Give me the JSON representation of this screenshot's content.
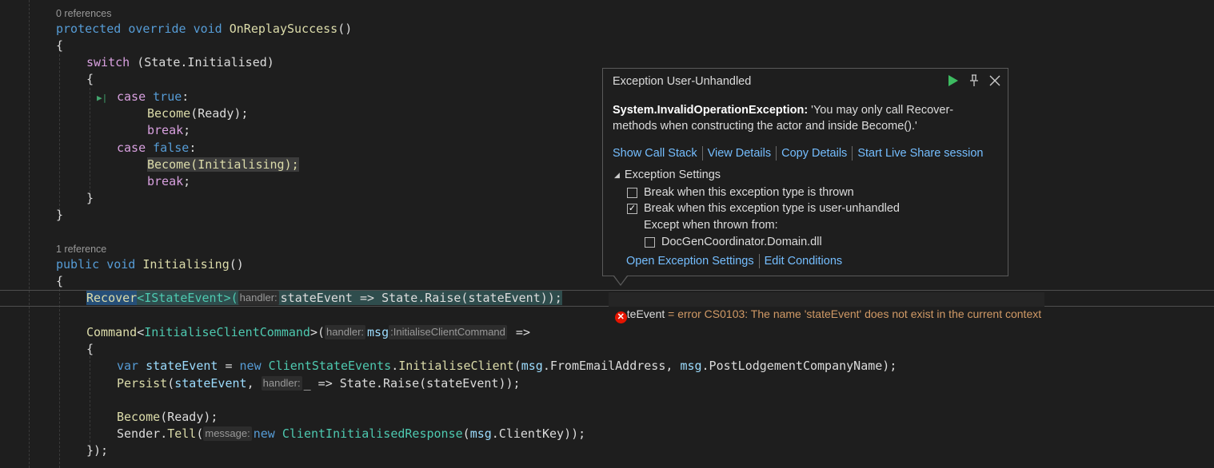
{
  "codelens": {
    "ref1": "0 references",
    "ref2": "1 reference"
  },
  "code": {
    "l1": {
      "protected": "protected",
      "override": "override",
      "void": "void",
      "name": "OnReplaySuccess",
      "rest": "()"
    },
    "l2": "{",
    "l3": {
      "switch": "switch",
      "rest": " (State.Initialised)"
    },
    "l4": "{",
    "l5": {
      "case": "case",
      "val": "true",
      "colon": ":"
    },
    "l6": {
      "fn": "Become",
      "rest": "(Ready);"
    },
    "l7": {
      "kw": "break",
      "semi": ";"
    },
    "l8": {
      "case": "case",
      "val": "false",
      "colon": ":"
    },
    "l9": {
      "text": "Become(Initialising);"
    },
    "l10": {
      "kw": "break",
      "semi": ";"
    },
    "l11": "}",
    "l12": "}",
    "l13": {
      "public": "public",
      "void": "void",
      "name": "Initialising",
      "rest": "()"
    },
    "l14": "{",
    "l15": {
      "recover": "Recover",
      "gen": "<IStateEvent>(",
      "hint": "handler:",
      "rest": "stateEvent => State.Raise(stateEvent));"
    },
    "l16": {
      "cmd": "Command",
      "lt": "<",
      "type": "InitialiseClientCommand",
      "gt": ">(",
      "hint1": "handler:",
      "msg": "msg",
      "hint2": ":InitialiseClientCommand",
      "arrow": " =>"
    },
    "l17": "{",
    "l18": {
      "var": "var",
      "name": "stateEvent",
      "eq": " = ",
      "new": "new",
      "type": "ClientStateEvents",
      "dot": ".",
      "fn": "InitialiseClient",
      "p1": "(",
      "msg1": "msg",
      "d1": ".FromEmailAddress, ",
      "msg2": "msg",
      "d2": ".PostLodgementCompanyName);"
    },
    "l19": {
      "fn": "Persist",
      "a": "(",
      "arg": "stateEvent",
      "comma": ", ",
      "hint": "handler:",
      "rest": "_ => State.Raise(stateEvent));"
    },
    "l20": {
      "fn": "Become",
      "rest": "(Ready);"
    },
    "l21": {
      "sender": "Sender",
      "dot": ".",
      "fn": "Tell",
      "p": "(",
      "hint": "message:",
      "new": "new",
      "type": "ClientInitialisedResponse",
      "rest1": "(",
      "msg": "msg",
      "rest2": ".ClientKey));"
    },
    "l22": "});"
  },
  "error_adornment": {
    "name": "teEvent",
    "eq": " = ",
    "message": "error CS0103: The name 'stateEvent' does not exist in the current context"
  },
  "popup": {
    "title": "Exception User-Unhandled",
    "exception_type": "System.InvalidOperationException:",
    "exception_message": " 'You may only call Recover-methods when constructing the actor and inside Become().'",
    "links": [
      "Show Call Stack",
      "View Details",
      "Copy Details",
      "Start Live Share session"
    ],
    "settings_header": "Exception Settings",
    "break_thrown": "Break when this exception type is thrown",
    "break_thrown_checked": false,
    "break_unhandled": "Break when this exception type is user-unhandled",
    "break_unhandled_checked": true,
    "except_label": "Except when thrown from:",
    "except_module": "DocGenCoordinator.Domain.dll",
    "except_module_checked": false,
    "bottom_links": [
      "Open Exception Settings",
      "Edit Conditions"
    ]
  },
  "colors": {
    "continue_icon": "#3dbb61",
    "error_icon": "#e51400",
    "link": "#75beff"
  }
}
